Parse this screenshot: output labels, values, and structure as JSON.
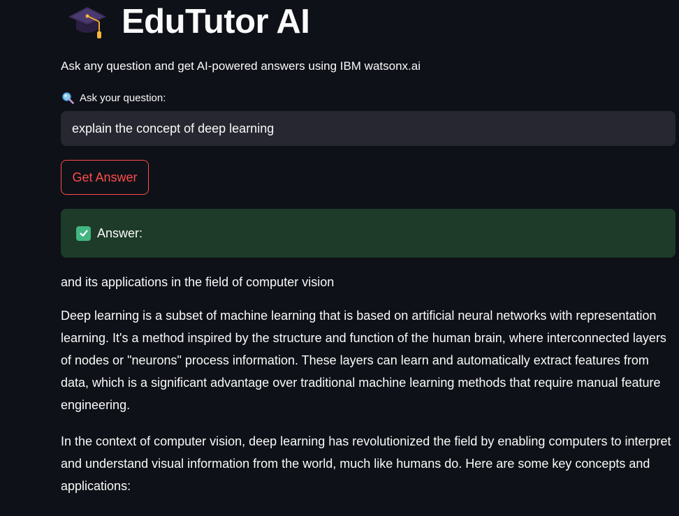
{
  "app": {
    "title": "EduTutor AI",
    "subtitle": "Ask any question and get AI-powered answers using IBM watsonx.ai"
  },
  "question": {
    "label": "Ask your question:",
    "value": "explain the concept of deep learning",
    "icon": "magnifying-glass-icon"
  },
  "actions": {
    "submit_label": "Get Answer"
  },
  "answer": {
    "header_label": "Answer:",
    "icon": "check-mark-icon",
    "paragraphs": [
      "and its applications in the field of computer vision",
      "Deep learning is a subset of machine learning that is based on artificial neural networks with representation learning. It's a method inspired by the structure and function of the human brain, where interconnected layers of nodes or \"neurons\" process information. These layers can learn and automatically extract features from data, which is a significant advantage over traditional machine learning methods that require manual feature engineering.",
      "In the context of computer vision, deep learning has revolutionized the field by enabling computers to interpret and understand visual information from the world, much like humans do. Here are some key concepts and applications:"
    ]
  },
  "colors": {
    "background": "#0e1117",
    "input_background": "#262730",
    "accent": "#ff4b4b",
    "success_background": "#1d3b28",
    "success_icon": "#43b581"
  }
}
